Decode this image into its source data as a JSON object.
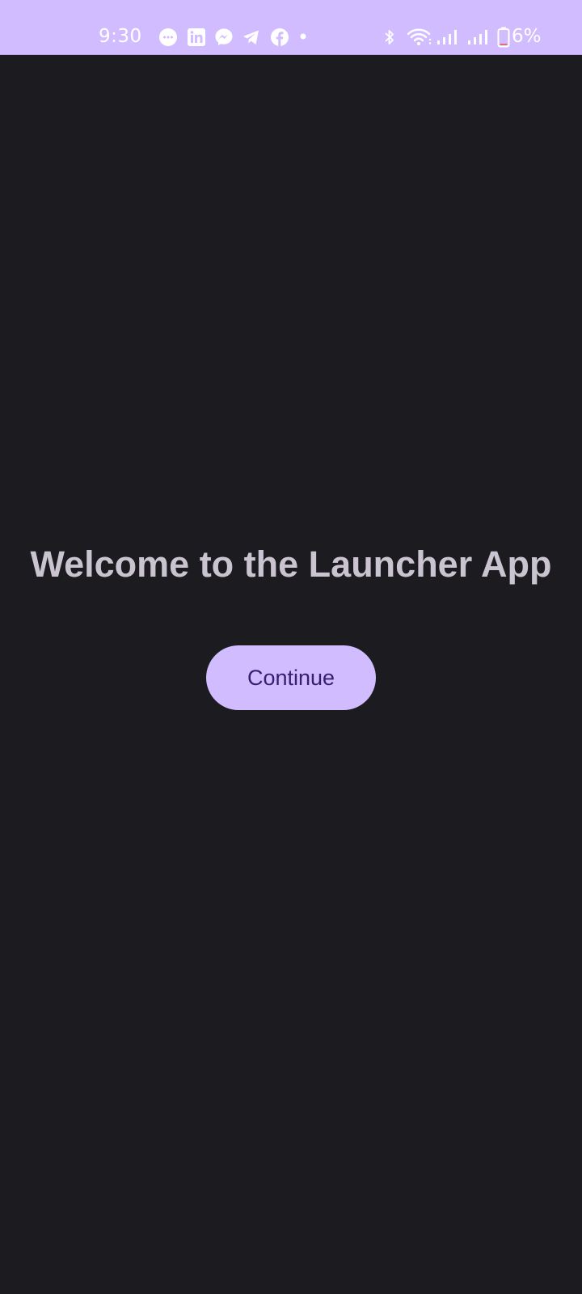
{
  "status_bar": {
    "time": "9:30",
    "battery_percent": "6%",
    "notification_icons": [
      "messages-icon",
      "linkedin-icon",
      "messenger-icon",
      "telegram-icon",
      "facebook-icon",
      "more-dot-icon"
    ],
    "system_icons": [
      "bluetooth-icon",
      "wifi-icon",
      "signal-icon-1",
      "signal-icon-2",
      "battery-icon"
    ],
    "background_color": "#d0bcfe"
  },
  "main": {
    "title": "Welcome to the Launcher App",
    "continue_button_label": "Continue",
    "background_color": "#1c1b20",
    "title_color": "#cac4d0",
    "button_color": "#d0bcfe",
    "button_text_color": "#381e72"
  }
}
